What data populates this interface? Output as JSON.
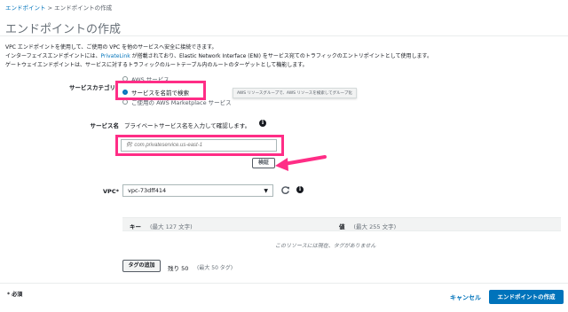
{
  "breadcrumb": {
    "parent": "エンドポイント",
    "separator": " > ",
    "current": "エンドポイントの作成"
  },
  "page_title": "エンドポイントの作成",
  "description": {
    "line1": "VPC エンドポイントを使用して、ご使用の VPC を他のサービスへ安全に接続できます。",
    "line2_pre": "インターフェイスエンドポイントには、",
    "line2_link": "PrivateLink",
    "line2_post": " が搭載されており、Elastic Network Interface (ENI) をサービス宛てのトラフィックのエントリポイントとして使用します。",
    "line3": "ゲートウェイエンドポイントは、サービスに対するトラフィックのルートテーブル内のルートのターゲットとして機能します。"
  },
  "service_category": {
    "label": "サービスカテゴリ",
    "options": [
      "AWS サービス",
      "サービスを名前で検索",
      "ご使用の AWS Marketplace サービス"
    ],
    "selected_index": 1,
    "tooltip": "AWS リソースグループで、AWS リソースを検索してグループ化"
  },
  "service_name": {
    "label": "サービス名",
    "hint": "プライベートサービス名を入力して確認します。",
    "placeholder": "例: com.privateservice.us-east-1",
    "verify_label": "検証"
  },
  "vpc": {
    "label": "VPC*",
    "value": "vpc-73dff414"
  },
  "tags": {
    "key_header": "キー",
    "key_hint": "(最大 127 文字)",
    "value_header": "値",
    "value_hint": "(最大 255 文字)",
    "empty_message": "このリソースには現在、タグがありません",
    "add_label": "タグの追加",
    "remaining_label": "残り 50",
    "max_label": "(最大 50 タグ)"
  },
  "footer": {
    "required_note": "* 必須",
    "cancel_label": "キャンセル",
    "create_label": "エンドポイントの作成"
  },
  "colors": {
    "accent": "#0073bb",
    "highlight": "#ff2d86",
    "header_bg": "#f2f3f3"
  }
}
